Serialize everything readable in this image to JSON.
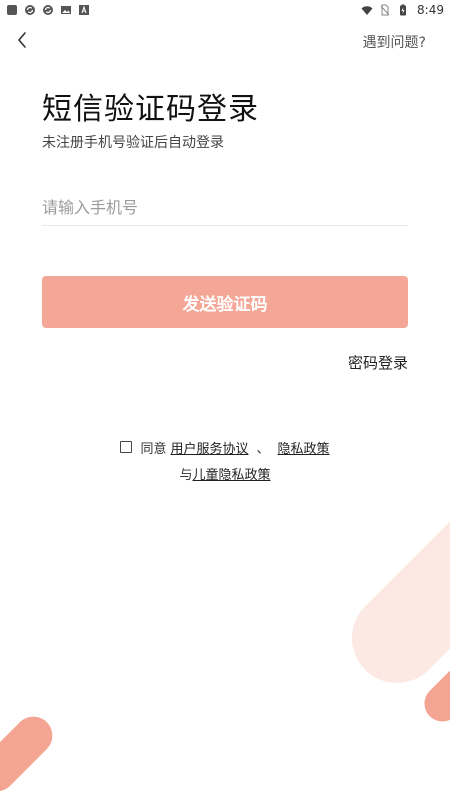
{
  "status_bar": {
    "time": "8:49",
    "left_icons": [
      "app-icon",
      "sync-icon",
      "sync-icon",
      "image-icon",
      "font-icon"
    ],
    "right_icons": [
      "wifi-icon",
      "no-sim-icon",
      "battery-charging-icon"
    ]
  },
  "nav": {
    "back_icon": "chevron-left-icon",
    "help": "遇到问题?"
  },
  "title": "短信验证码登录",
  "subtitle": "未注册手机号验证后自动登录",
  "phone_input": {
    "placeholder": "请输入手机号",
    "value": ""
  },
  "send_code_button": "发送验证码",
  "password_login": "密码登录",
  "agreement": {
    "prefix": "同意",
    "user_agreement": "用户服务协议",
    "separator": "、",
    "privacy_policy": "隐私政策",
    "child_prefix": "与",
    "child_privacy": "儿童隐私政策",
    "checked": false
  },
  "colors": {
    "accent": "#f5a797",
    "decor_light": "#fde9e3",
    "decor_dark": "#f4a493"
  }
}
